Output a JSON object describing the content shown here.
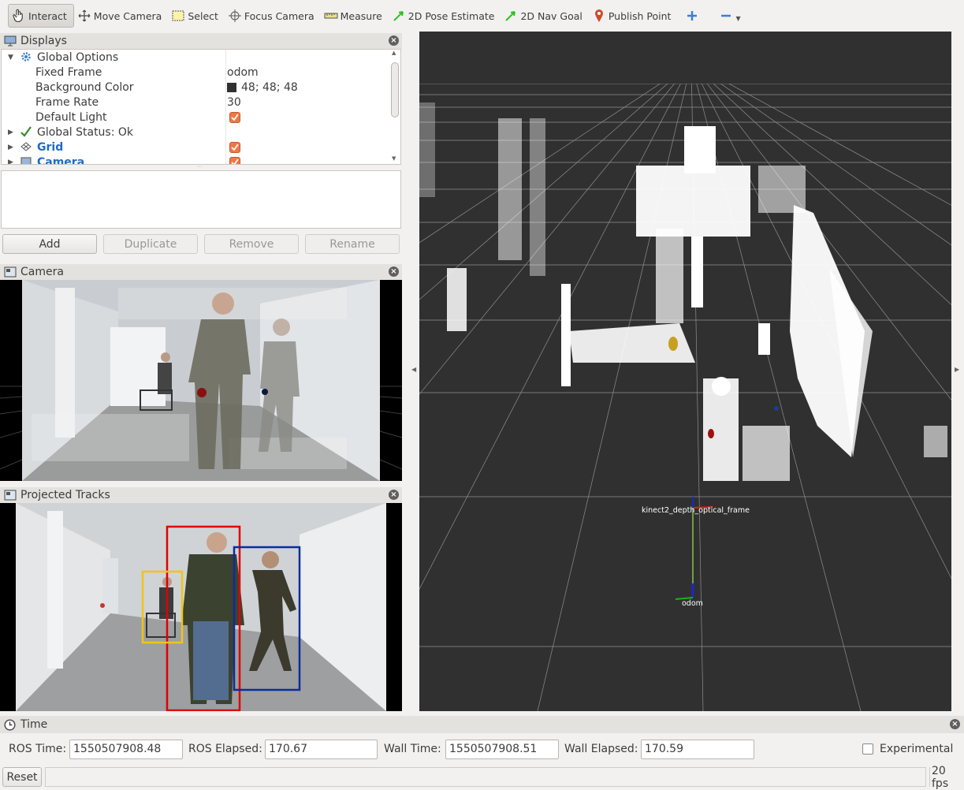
{
  "toolbar": {
    "tools": [
      {
        "label": "Interact",
        "icon": "hand-cursor-icon"
      },
      {
        "label": "Move Camera",
        "icon": "move-arrows-icon"
      },
      {
        "label": "Select",
        "icon": "select-box-icon"
      },
      {
        "label": "Focus Camera",
        "icon": "crosshair-icon"
      },
      {
        "label": "Measure",
        "icon": "ruler-icon"
      },
      {
        "label": "2D Pose Estimate",
        "icon": "green-arrow-icon"
      },
      {
        "label": "2D Nav Goal",
        "icon": "green-arrow-icon"
      },
      {
        "label": "Publish Point",
        "icon": "map-pin-icon"
      }
    ]
  },
  "displays": {
    "title": "Displays",
    "rows": [
      {
        "name": "Global Options",
        "value": ""
      },
      {
        "name": "Fixed Frame",
        "value": "odom"
      },
      {
        "name": "Background Color",
        "value": "48; 48; 48"
      },
      {
        "name": "Frame Rate",
        "value": "30"
      },
      {
        "name": "Default Light",
        "value": ""
      },
      {
        "name": "Global Status: Ok",
        "value": ""
      },
      {
        "name": "Grid",
        "value": ""
      },
      {
        "name": "Camera",
        "value": ""
      }
    ],
    "buttons": {
      "add": "Add",
      "duplicate": "Duplicate",
      "remove": "Remove",
      "rename": "Rename"
    }
  },
  "camera_panel": {
    "title": "Camera"
  },
  "tracks_panel": {
    "title": "Projected Tracks"
  },
  "view3d": {
    "frame_label": "kinect2_depth_optical_frame",
    "odom_label": "odom"
  },
  "time": {
    "title": "Time",
    "ros_time_label": "ROS Time:",
    "ros_time": "1550507908.48",
    "ros_elapsed_label": "ROS Elapsed:",
    "ros_elapsed": "170.67",
    "wall_time_label": "Wall Time:",
    "wall_time": "1550507908.51",
    "wall_elapsed_label": "Wall Elapsed:",
    "wall_elapsed": "170.59",
    "experimental_label": "Experimental"
  },
  "status": {
    "reset_label": "Reset",
    "fps": "20 fps"
  },
  "colors": {
    "background_3d": "#303030",
    "checkbox": "#f07746",
    "link_blue": "#1e6cc4",
    "status_green": "#3a8a2c"
  }
}
